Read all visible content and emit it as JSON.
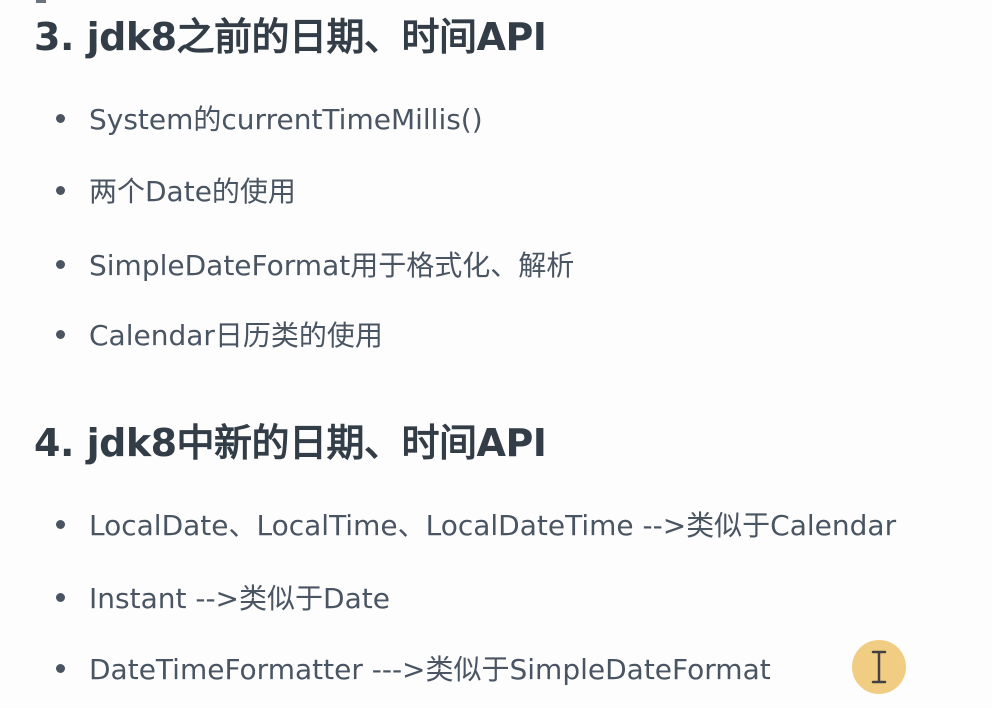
{
  "section3": {
    "heading": "3. jdk8之前的日期、时间API",
    "items": [
      "System的currentTimeMillis()",
      "两个Date的使用",
      "SimpleDateFormat用于格式化、解析",
      "Calendar日历类的使用"
    ]
  },
  "section4": {
    "heading": "4. jdk8中新的日期、时间API",
    "items": [
      "LocalDate、LocalTime、LocalDateTime -->类似于Calendar",
      "Instant  -->类似于Date",
      "DateTimeFormatter --->类似于SimpleDateFormat"
    ]
  },
  "cursor": {
    "icon": "text-cursor-icon",
    "highlight_color": "#f0c46e"
  }
}
